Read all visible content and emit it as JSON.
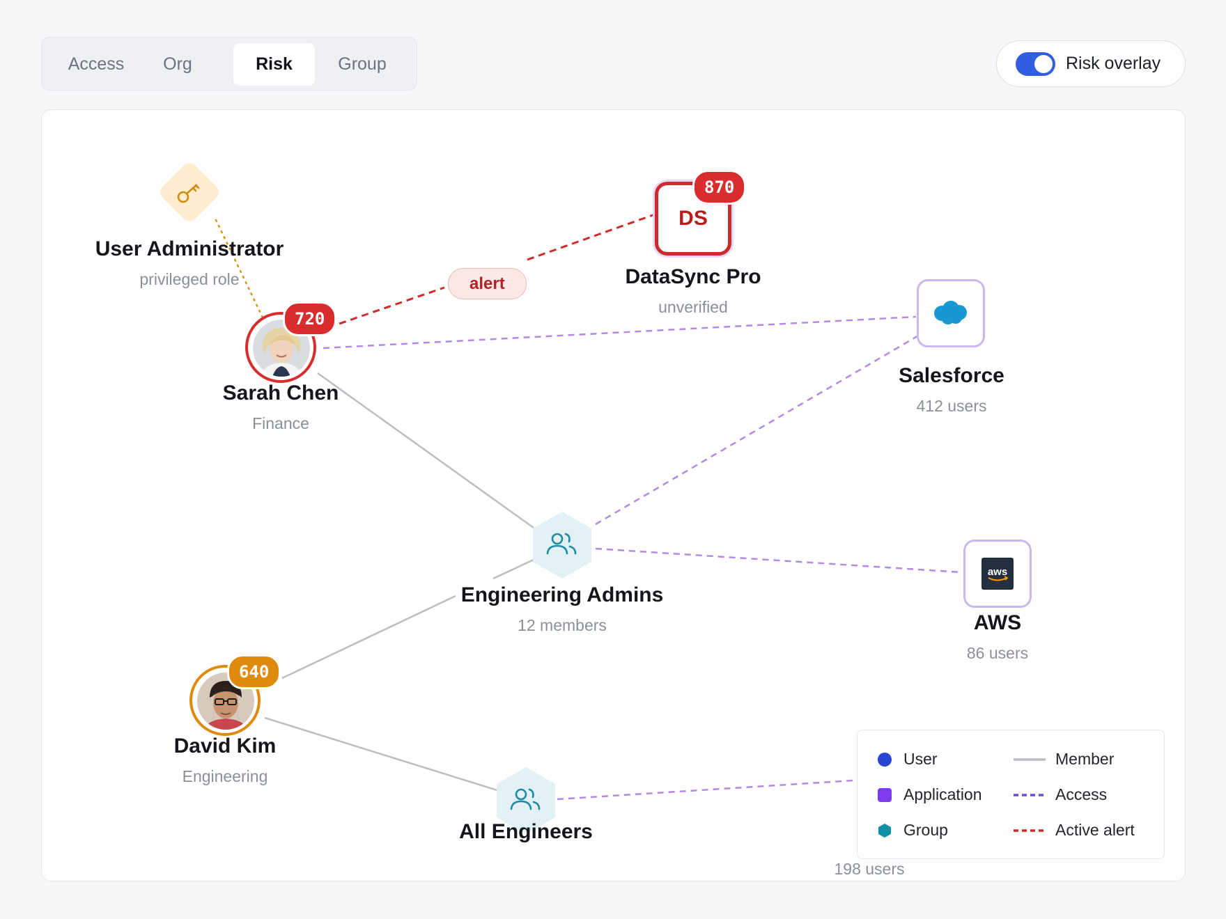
{
  "tabs": [
    {
      "label": "Access",
      "active": false
    },
    {
      "label": "Org",
      "active": false
    },
    {
      "label": "Risk",
      "active": true
    },
    {
      "label": "Group",
      "active": false
    }
  ],
  "toggle": {
    "label": "Risk overlay",
    "on": true
  },
  "nodes": {
    "user_admin": {
      "title": "User Administrator",
      "subtitle": "privileged role",
      "icon": "key-icon"
    },
    "datasync": {
      "title": "DataSync Pro",
      "subtitle": "unverified",
      "initials": "DS",
      "score": "870"
    },
    "sarah": {
      "title": "Sarah Chen",
      "subtitle": "Finance",
      "score": "720"
    },
    "salesforce": {
      "title": "Salesforce",
      "subtitle": "412 users",
      "icon": "salesforce-cloud-icon"
    },
    "eng_admins": {
      "title": "Engineering Admins",
      "subtitle": "12 members",
      "icon": "group-icon"
    },
    "aws": {
      "title": "AWS",
      "subtitle": "86 users",
      "logo_text": "aws",
      "icon": "aws-logo-icon"
    },
    "david": {
      "title": "David Kim",
      "subtitle": "Engineering",
      "score": "640"
    },
    "all_engineers": {
      "title": "All Engineers",
      "subtitle": "198 users",
      "icon": "group-icon"
    }
  },
  "edges": {
    "alert_label": "alert"
  },
  "legend": {
    "items": [
      {
        "label": "User",
        "kind": "node",
        "color": "#2746d6"
      },
      {
        "label": "Application",
        "kind": "node",
        "color": "#7c3aed"
      },
      {
        "label": "Group",
        "kind": "node",
        "color": "#0e8fa5"
      },
      {
        "label": "Member",
        "kind": "edge",
        "color": "#b8bcc3"
      },
      {
        "label": "Access",
        "kind": "edge",
        "color": "#6d4ad6"
      },
      {
        "label": "Active alert",
        "kind": "edge",
        "color": "#cf2b2b"
      }
    ]
  },
  "colors": {
    "risk_high": "#d92d2d",
    "risk_medium": "#e08a0b",
    "access_edge": "#b08ae6",
    "member_edge": "#bdbdbd",
    "group_fill": "#e2f1f5"
  }
}
